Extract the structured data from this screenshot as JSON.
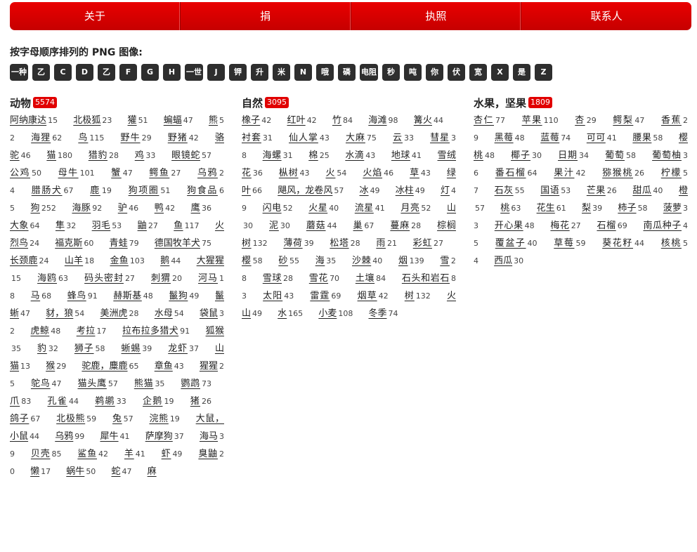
{
  "nav": [
    "关于",
    "捐",
    "执照",
    "联系人"
  ],
  "alpha_heading": "按字母顺序排列的 PNG 图像:",
  "alpha": [
    "一种",
    "乙",
    "C",
    "D",
    "乙",
    "F",
    "G",
    "H",
    "一世",
    "J",
    "钾",
    "升",
    "米",
    "N",
    "哦",
    "磷",
    "电阻",
    "秒",
    "吨",
    "你",
    "伏",
    "宽",
    "X",
    "是",
    "Z"
  ],
  "columns": [
    {
      "title": "动物",
      "count": "5574",
      "items": [
        [
          "阿纳康达",
          "15"
        ],
        [
          "北极狐",
          "23"
        ],
        [
          "獾",
          "51"
        ],
        [
          "蝙蝠",
          "47"
        ],
        [
          "熊",
          "52"
        ],
        [
          "海狸",
          "62"
        ],
        [
          "鸟",
          "115"
        ],
        [
          "野牛",
          "29"
        ],
        [
          "野猪",
          "42"
        ],
        [
          "骆驼",
          "46"
        ],
        [
          "猫",
          "180"
        ],
        [
          "猎豹",
          "28"
        ],
        [
          "鸡",
          "33"
        ],
        [
          "眼镜蛇",
          "57"
        ],
        [
          "公鸡",
          "50"
        ],
        [
          "母牛",
          "101"
        ],
        [
          "蟹",
          "47"
        ],
        [
          "鳄鱼",
          "27"
        ],
        [
          "乌鸦",
          "24"
        ],
        [
          "腊肠犬",
          "67"
        ],
        [
          "鹿",
          "19"
        ],
        [
          "狗项圈",
          "51"
        ],
        [
          "狗食品",
          "65"
        ],
        [
          "狗",
          "252"
        ],
        [
          "海豚",
          "92"
        ],
        [
          "驴",
          "46"
        ],
        [
          "鸭",
          "42"
        ],
        [
          "鹰",
          "36"
        ],
        [
          "大象",
          "64"
        ],
        [
          "隼",
          "32"
        ],
        [
          "羽毛",
          "53"
        ],
        [
          "鼬",
          "27"
        ],
        [
          "鱼",
          "117"
        ],
        [
          "火烈鸟",
          "24"
        ],
        [
          "福克斯",
          "60"
        ],
        [
          "青蛙",
          "79"
        ],
        [
          "德国牧羊犬",
          "75"
        ],
        [
          "长颈鹿",
          "24"
        ],
        [
          "山羊",
          "18"
        ],
        [
          "金鱼",
          "103"
        ],
        [
          "鹅",
          "44"
        ],
        [
          "大猩猩",
          "15"
        ],
        [
          "海鸥",
          "63"
        ],
        [
          "码头密封",
          "27"
        ],
        [
          "刺猬",
          "20"
        ],
        [
          "河马",
          "18"
        ],
        [
          "马",
          "68"
        ],
        [
          "蜂鸟",
          "91"
        ],
        [
          "赫斯基",
          "48"
        ],
        [
          "鬣狗",
          "49"
        ],
        [
          "鬣蜥",
          "47"
        ],
        [
          "豺，狼",
          "54"
        ],
        [
          "美洲虎",
          "28"
        ],
        [
          "水母",
          "54"
        ],
        [
          "袋鼠",
          "32"
        ],
        [
          "虎鲸",
          "48"
        ],
        [
          "考拉",
          "17"
        ],
        [
          "拉布拉多猎犬",
          "91"
        ],
        [
          "狐猴",
          "35"
        ],
        [
          "豹",
          "32"
        ],
        [
          "狮子",
          "58"
        ],
        [
          "蜥蜴",
          "39"
        ],
        [
          "龙虾",
          "37"
        ],
        [
          "山猫",
          "13"
        ],
        [
          "猴",
          "29"
        ],
        [
          "驼鹿，麋鹿",
          "65"
        ],
        [
          "章鱼",
          "43"
        ],
        [
          "猩猩",
          "25"
        ],
        [
          "鸵鸟",
          "47"
        ],
        [
          "猫头鹰",
          "57"
        ],
        [
          "熊猫",
          "35"
        ],
        [
          "鹦鹉",
          "73"
        ],
        [
          "爪",
          "83"
        ],
        [
          "孔雀",
          "44"
        ],
        [
          "鹈鹕",
          "33"
        ],
        [
          "企鹅",
          "19"
        ],
        [
          "猪",
          "26"
        ],
        [
          "鸽子",
          "67"
        ],
        [
          "北极熊",
          "59"
        ],
        [
          "兔",
          "57"
        ],
        [
          "浣熊",
          "19"
        ],
        [
          "大鼠，小鼠",
          "44"
        ],
        [
          "乌鸦",
          "99"
        ],
        [
          "犀牛",
          "41"
        ],
        [
          "萨摩狗",
          "37"
        ],
        [
          "海马",
          "39"
        ],
        [
          "贝壳",
          "85"
        ],
        [
          "鲨鱼",
          "42"
        ],
        [
          "羊",
          "41"
        ],
        [
          "虾",
          "49"
        ],
        [
          "臭鼬",
          "20"
        ],
        [
          "懒",
          "17"
        ],
        [
          "蜗牛",
          "50"
        ],
        [
          "蛇",
          "47"
        ],
        [
          "麻"
        ]
      ]
    },
    {
      "title": "自然",
      "count": "3095",
      "items": [
        [
          "橡子",
          "42"
        ],
        [
          "红叶",
          "42"
        ],
        [
          "竹",
          "84"
        ],
        [
          "海滩",
          "98"
        ],
        [
          "篝火",
          "44"
        ],
        [
          "衬套",
          "31"
        ],
        [
          "仙人掌",
          "43"
        ],
        [
          "大麻",
          "75"
        ],
        [
          "云",
          "33"
        ],
        [
          "彗星",
          "38"
        ],
        [
          "海螺",
          "31"
        ],
        [
          "棉",
          "25"
        ],
        [
          "水滴",
          "43"
        ],
        [
          "地球",
          "41"
        ],
        [
          "雪绒花",
          "36"
        ],
        [
          "枞树",
          "43"
        ],
        [
          "火",
          "54"
        ],
        [
          "火焰",
          "46"
        ],
        [
          "草",
          "43"
        ],
        [
          "绿叶",
          "66"
        ],
        [
          "飓风，龙卷风",
          "57"
        ],
        [
          "冰",
          "49"
        ],
        [
          "冰柱",
          "49"
        ],
        [
          "灯",
          "49"
        ],
        [
          "闪电",
          "52"
        ],
        [
          "火星",
          "40"
        ],
        [
          "流星",
          "41"
        ],
        [
          "月亮",
          "52"
        ],
        [
          "山",
          "30"
        ],
        [
          "泥",
          "30"
        ],
        [
          "蘑菇",
          "44"
        ],
        [
          "巢",
          "67"
        ],
        [
          "蔓麻",
          "28"
        ],
        [
          "棕榈树",
          "132"
        ],
        [
          "薄荷",
          "39"
        ],
        [
          "松塔",
          "28"
        ],
        [
          "雨",
          "21"
        ],
        [
          "彩虹",
          "27"
        ],
        [
          "樱",
          "58"
        ],
        [
          "砂",
          "55"
        ],
        [
          "海",
          "35"
        ],
        [
          "沙棘",
          "40"
        ],
        [
          "烟",
          "139"
        ],
        [
          "雪",
          "28"
        ],
        [
          "雪球",
          "28"
        ],
        [
          "雪花",
          "70"
        ],
        [
          "土壤",
          "84"
        ],
        [
          "石头和岩石",
          "83"
        ],
        [
          "太阳",
          "43"
        ],
        [
          "雷霆",
          "69"
        ],
        [
          "烟草",
          "42"
        ],
        [
          "树",
          "132"
        ],
        [
          "火山",
          "49"
        ],
        [
          "水",
          "165"
        ],
        [
          "小麦",
          "108"
        ],
        [
          "冬季",
          "74"
        ]
      ]
    },
    {
      "title": "水果，坚果",
      "count": "1809",
      "items": [
        [
          "杏仁",
          "77"
        ],
        [
          "苹果",
          "110"
        ],
        [
          "杏",
          "29"
        ],
        [
          "鳄梨",
          "47"
        ],
        [
          "香蕉",
          "29"
        ],
        [
          "黑莓",
          "48"
        ],
        [
          "蓝莓",
          "74"
        ],
        [
          "可可",
          "41"
        ],
        [
          "腰果",
          "58"
        ],
        [
          "樱桃",
          "48"
        ],
        [
          "椰子",
          "30"
        ],
        [
          "日期",
          "34"
        ],
        [
          "葡萄",
          "58"
        ],
        [
          "葡萄柚",
          "36"
        ],
        [
          "番石榴",
          "64"
        ],
        [
          "果汁",
          "42"
        ],
        [
          "猕猴桃",
          "26"
        ],
        [
          "柠檬",
          "57"
        ],
        [
          "石灰",
          "55"
        ],
        [
          "国语",
          "53"
        ],
        [
          "芒果",
          "26"
        ],
        [
          "甜瓜",
          "40"
        ],
        [
          "橙",
          "57"
        ],
        [
          "桃",
          "63"
        ],
        [
          "花生",
          "61"
        ],
        [
          "梨",
          "39"
        ],
        [
          "柿子",
          "58"
        ],
        [
          "菠萝",
          "33"
        ],
        [
          "开心果",
          "48"
        ],
        [
          "梅花",
          "27"
        ],
        [
          "石榴",
          "69"
        ],
        [
          "南瓜种子",
          "45"
        ],
        [
          "覆盆子",
          "40"
        ],
        [
          "草莓",
          "59"
        ],
        [
          "葵花籽",
          "44"
        ],
        [
          "核桃",
          "54"
        ],
        [
          "西瓜",
          "30"
        ]
      ]
    }
  ]
}
